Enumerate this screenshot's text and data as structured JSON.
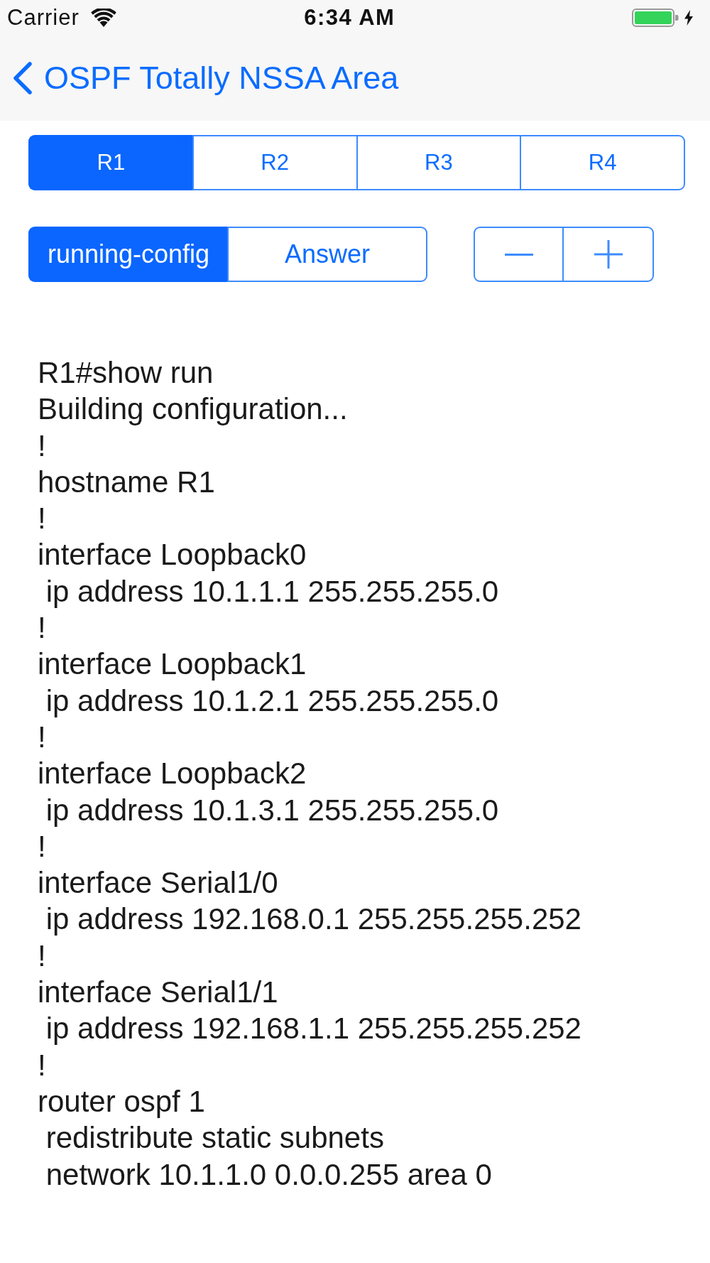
{
  "status_bar": {
    "carrier": "Carrier",
    "time": "6:34 AM"
  },
  "nav_bar": {
    "back_title": "OSPF Totally NSSA Area"
  },
  "router_tabs": [
    {
      "label": "R1",
      "selected": true
    },
    {
      "label": "R2",
      "selected": false
    },
    {
      "label": "R3",
      "selected": false
    },
    {
      "label": "R4",
      "selected": false
    }
  ],
  "view_tabs": [
    {
      "label": "running-config",
      "selected": true
    },
    {
      "label": "Answer",
      "selected": false
    }
  ],
  "config_lines": [
    "R1#show run",
    "Building configuration...",
    "!",
    "hostname R1",
    "!",
    "interface Loopback0",
    " ip address 10.1.1.1 255.255.255.0",
    "!",
    "interface Loopback1",
    " ip address 10.1.2.1 255.255.255.0",
    "!",
    "interface Loopback2",
    " ip address 10.1.3.1 255.255.255.0",
    "!",
    "interface Serial1/0",
    " ip address 192.168.0.1 255.255.255.252",
    "!",
    "interface Serial1/1",
    " ip address 192.168.1.1 255.255.255.252",
    "!",
    "router ospf 1",
    " redistribute static subnets",
    " network 10.1.1.0 0.0.0.255 area 0"
  ]
}
